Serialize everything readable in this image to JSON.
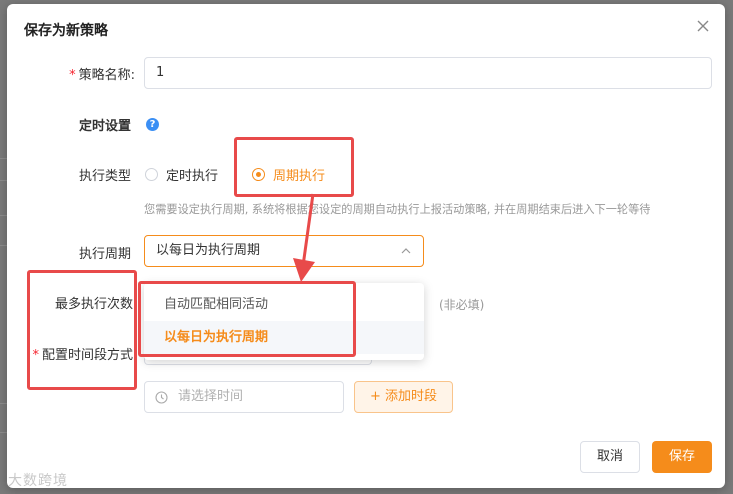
{
  "dialog": {
    "title": "保存为新策略"
  },
  "form": {
    "name_label": "策略名称:",
    "name_value": "1",
    "timer_label": "定时设置",
    "help_glyph": "?",
    "type_label": "执行类型",
    "type_options": [
      "定时执行",
      "周期执行"
    ],
    "type_selected": "周期执行",
    "hint": "您需要设定执行周期, 系统将根据您设定的周期自动执行上报活动策略, 并在周期结束后进入下一轮等待",
    "period_label": "执行周期",
    "period_value": "以每日为执行周期",
    "period_options": [
      "自动匹配相同活动",
      "以每日为执行周期"
    ],
    "max_label": "最多执行次数",
    "max_hint": "(非必填)",
    "time_label": "配置时间段方式",
    "time_placeholder": "请选择时间",
    "add_segment": "+ 添加时段"
  },
  "footer": {
    "cancel": "取消",
    "save": "保存"
  },
  "colors": {
    "accent": "#f58c1b",
    "highlight": "#e84a4a",
    "required": "#f5222d"
  },
  "watermark": "大数跨境"
}
